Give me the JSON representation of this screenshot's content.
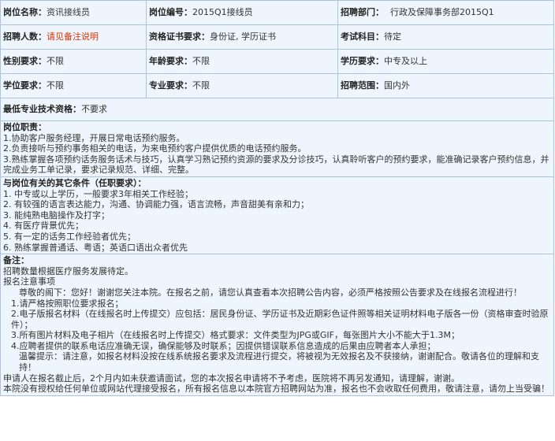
{
  "fields": {
    "name_label": "岗位名称：",
    "name_value": "资讯接线员",
    "code_label": "岗位编号：",
    "code_value": "2015Q1接线员",
    "dept_label": "招聘部门：",
    "dept_value": "行政及保障事务部2015Q1",
    "count_label": "招聘人数：",
    "count_value": "请见备注说明",
    "cert_label": "资格证书要求：",
    "cert_value": "身份证, 学历证书",
    "exam_label": "考试科目：",
    "exam_value": "待定",
    "gender_label": "性别要求：",
    "gender_value": "不限",
    "age_label": "年龄要求：",
    "age_value": "不限",
    "edu_label": "学历要求：",
    "edu_value": "中专及以上",
    "degree_label": "学位要求：",
    "degree_value": "不限",
    "major_label": "专业要求：",
    "major_value": "不限",
    "scope_label": "招聘范围：",
    "scope_value": "国内外",
    "tech_label": "最低专业技术资格：",
    "tech_value": "不要求"
  },
  "duties": {
    "title": "岗位职责：",
    "lines": [
      "1.协助客户服务经理，开展日常电话预约服务。",
      "2.负责接听与预约事务相关的电话，为来电预约客户提供优质的电话预约服务。",
      "3.熟练掌握各项预约话务服务话术与技巧，认真学习熟记预约资源的要求及分诊技巧，认真聆听客户的预约要求，能准确记录客户预约信息，并完成业务工单记录，要求记录规范、详细、完整。"
    ]
  },
  "conditions": {
    "title": "与岗位有关的其它条件（任职要求）：",
    "lines": [
      "1. 中专或以上学历，一般要求3年相关工作经验；",
      "2. 有较强的语言表达能力，沟通、协调能力强，语言流畅，声音甜美有亲和力；",
      "3.  能纯熟电脑操作及打字；",
      "4.  有医疗背景优先；",
      "5.  有一定的话务工作经验者优先；",
      "6.  熟练掌握普通话、粤语；英语口语出众者优先"
    ]
  },
  "notes": {
    "title": "备注：",
    "lines": [
      "招聘数量根据医疗服务发展待定。",
      "报名注意事项",
      "尊敬的阁下：您好！谢谢您关注本院。在报名之前，请您认真查看本次招聘公告内容，必须严格按照公告要求及在线报名流程进行！",
      "1.请严格按照职位要求报名；",
      "2.电子版报名材料（在线报名时上传提交）应包括：居民身份证、学历证书及近期彩色证件照等相关证明材料电子版各一份（资格审查时验原件）；",
      "3.所有图片材料及电子相片（在线报名时上传提交）格式要求：文件类型为JPG或GIF，每张图片大小不能大于1.3M；",
      "4.应聘者提供的联系电话应准确无误，确保能够及时联系；因提供错误联系信息造成的后果由应聘者本人承担；",
      "温馨提示：请注意，如报名材料没按在线系统报名要求及流程进行提交，将被视为无效报名及不获接纳，谢谢配合。敬请各位的理解和支持！",
      "申请人在报名截止后，2个月内如未获邀请面试，您的本次报名申请将不予考虑，医院将不再另发通知，请理解，谢谢。",
      "本院没有授权给任何单位或网站代理接受报名，所有报名信息以本院官方招聘网站为准，报名也不会收取任何费用，敬请注意，请勿上当受骗！"
    ]
  }
}
